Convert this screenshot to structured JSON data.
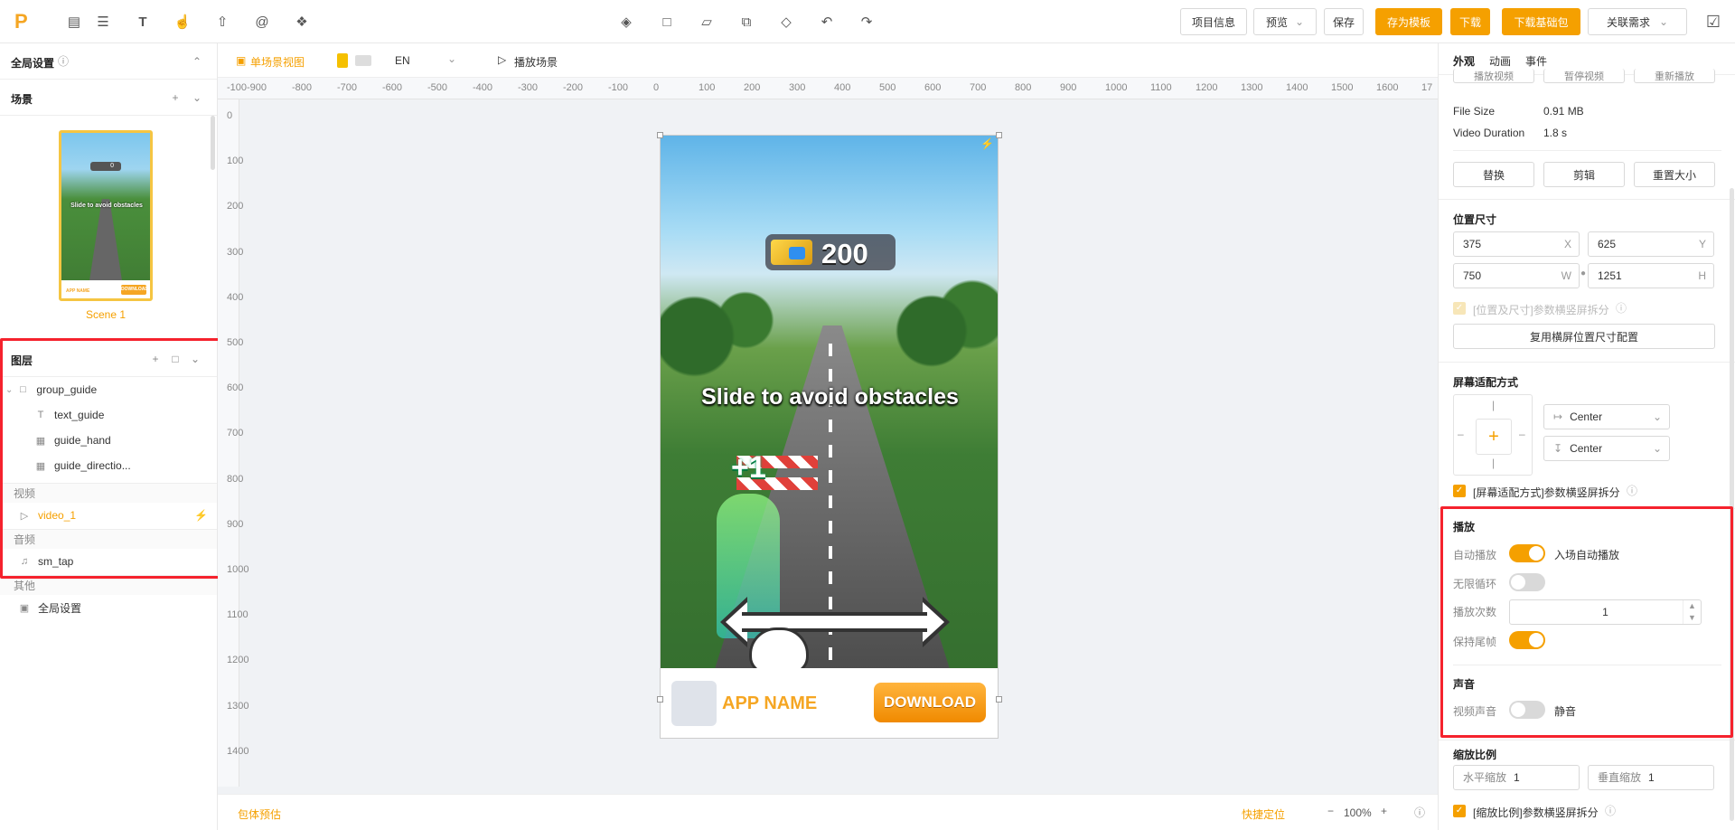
{
  "topbar": {
    "icons": [
      "layers-icon",
      "inbox-icon",
      "list-icon",
      "text-icon",
      "gesture-icon",
      "upload-icon",
      "at-icon",
      "plugin-icon"
    ],
    "center_icons": [
      "stack-icon",
      "folder-icon",
      "folder-open-icon",
      "copy-icon",
      "eraser-icon",
      "undo-icon",
      "redo-icon"
    ],
    "project_info": "项目信息",
    "preview": "预览",
    "save": "保存",
    "save_template": "存为模板",
    "download": "下载",
    "download_base": "下载基础包",
    "related": "关联需求"
  },
  "left": {
    "global_settings": "全局设置",
    "scenes_title": "场景",
    "scene_name": "Scene 1",
    "thumb_text": "Slide to avoid obstacles",
    "thumb_score": "0",
    "thumb_app": "APP NAME",
    "thumb_download": "DOWNLOAD",
    "layers_title": "图层",
    "layers": [
      {
        "name": "group_guide",
        "icon": "folder-icon"
      },
      {
        "name": "text_guide",
        "icon": "text-icon"
      },
      {
        "name": "guide_hand",
        "icon": "image-icon"
      },
      {
        "name": "guide_directio...",
        "icon": "image-icon"
      }
    ],
    "video_group": "视频",
    "video_item": "video_1",
    "audio_group": "音频",
    "audio_item": "sm_tap",
    "other_group": "其他",
    "other_item": "全局设置"
  },
  "canvas": {
    "single_view": "单场景视图",
    "lang": "EN",
    "play_scene": "播放场景",
    "h_ruler": [
      "-100",
      "-900",
      "-800",
      "-700",
      "-600",
      "-500",
      "-400",
      "-300",
      "-200",
      "-100",
      "0",
      "100",
      "200",
      "300",
      "400",
      "500",
      "600",
      "700",
      "800",
      "900",
      "1000",
      "1100",
      "1200",
      "1300",
      "1400",
      "1500",
      "1600",
      "17"
    ],
    "v_ruler": [
      "0",
      "100",
      "200",
      "300",
      "400",
      "500",
      "600",
      "700",
      "800",
      "900",
      "1000",
      "1100",
      "1200",
      "1300",
      "1400"
    ],
    "score": "200",
    "slide_text": "Slide to avoid obstacles",
    "plus_one": "+1",
    "app_name": "APP NAME",
    "download_btn": "DOWNLOAD",
    "bottom_left": "包体预估",
    "quick_locate": "快捷定位",
    "zoom": "100%",
    "zoom_minus": "−",
    "zoom_plus": "+"
  },
  "right": {
    "tabs": [
      "外观",
      "动画",
      "事件"
    ],
    "top_buttons": [
      "播放视频",
      "暂停视频",
      "重新播放"
    ],
    "file_size_label": "File Size",
    "file_size": "0.91 MB",
    "duration_label": "Video Duration",
    "duration": "1.8 s",
    "actions": [
      "替换",
      "剪辑",
      "重置大小"
    ],
    "position_title": "位置尺寸",
    "x": "375",
    "x_label": "X",
    "y": "625",
    "y_label": "Y",
    "w": "750",
    "w_label": "W",
    "h": "1251",
    "h_label": "H",
    "pos_split": "[位置及尺寸]参数横竖屏拆分",
    "reuse_btn": "复用横屏位置尺寸配置",
    "adapt_title": "屏幕适配方式",
    "h_align": "Center",
    "v_align": "Center",
    "adapt_split": "[屏幕适配方式]参数横竖屏拆分",
    "play_title": "播放",
    "autoplay_label": "自动播放",
    "autoplay_text": "入场自动播放",
    "loop_label": "无限循环",
    "count_label": "播放次数",
    "count": "1",
    "keep_last_label": "保持尾帧",
    "sound_title": "声音",
    "video_sound_label": "视频声音",
    "mute_text": "静音",
    "scale_title": "缩放比例",
    "h_scale_label": "水平缩放",
    "h_scale": "1",
    "v_scale_label": "垂直缩放",
    "v_scale": "1",
    "scale_split": "[缩放比例]参数横竖屏拆分"
  },
  "colors": {
    "accent": "#f5a000",
    "highlight": "#f5222d"
  }
}
